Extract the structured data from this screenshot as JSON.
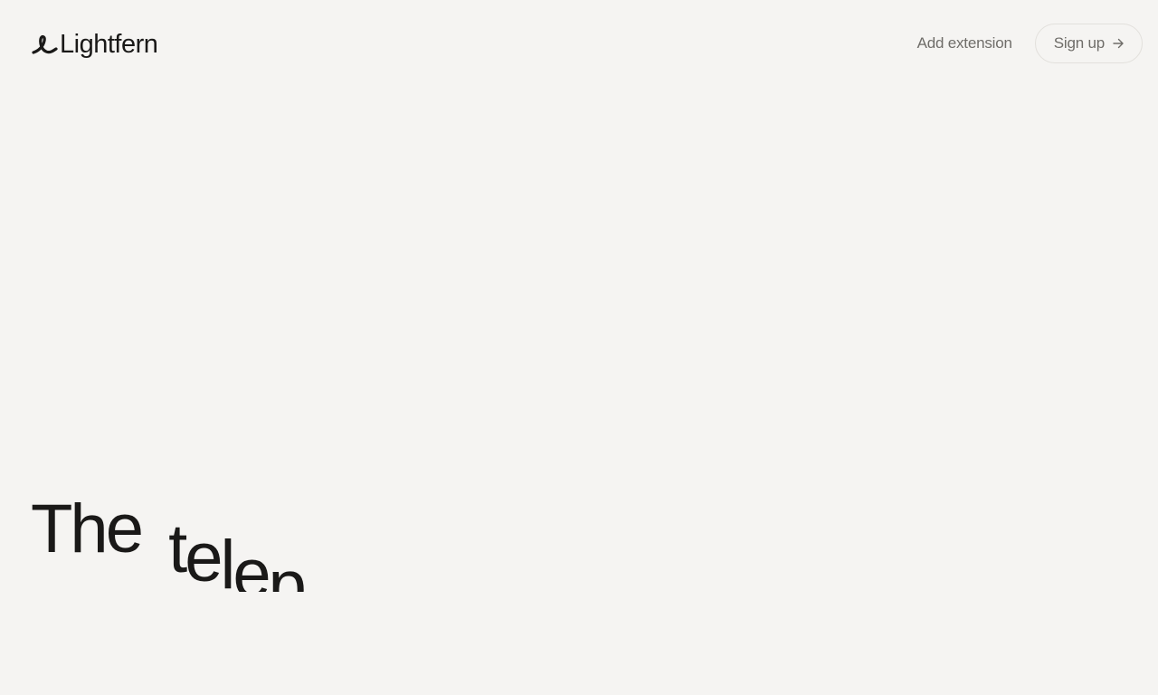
{
  "brand": {
    "name": "Lightfern",
    "logo_icon": "loop-leaf-icon"
  },
  "nav": {
    "add_extension": "Add extension",
    "signup_label": "Sign up",
    "signup_icon": "arrow-right-icon"
  },
  "hero": {
    "word1": "The",
    "word2_visible": "telep"
  },
  "colors": {
    "background": "#f5f4f2",
    "text": "#1a1918",
    "muted": "#6f6d69",
    "border": "#e2e0dc"
  }
}
